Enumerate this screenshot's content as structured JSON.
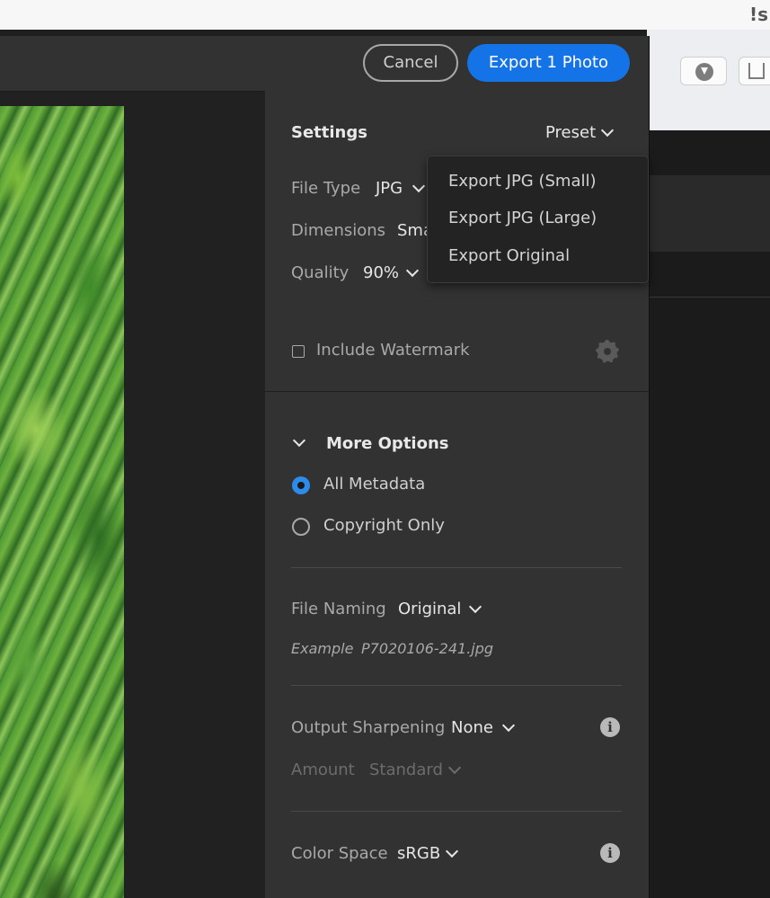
{
  "dialog": {
    "cancel_label": "Cancel",
    "export_label": "Export 1 Photo"
  },
  "settings": {
    "title": "Settings",
    "preset_label": "Preset",
    "file_type_label": "File Type",
    "file_type_value": "JPG",
    "dimensions_label": "Dimensions",
    "dimensions_value": "Sma",
    "quality_label": "Quality",
    "quality_value": "90%",
    "watermark_label": "Include Watermark",
    "watermark_checked": false
  },
  "preset_menu": {
    "items": [
      "Export JPG (Small)",
      "Export JPG (Large)",
      "Export Original"
    ]
  },
  "more_options": {
    "title": "More Options",
    "metadata_options": [
      {
        "label": "All Metadata",
        "selected": true
      },
      {
        "label": "Copyright Only",
        "selected": false
      }
    ],
    "file_naming_label": "File Naming",
    "file_naming_value": "Original",
    "example_label": "Example",
    "example_value": "P7020106-241.jpg",
    "output_sharpening_label": "Output Sharpening",
    "output_sharpening_value": "None",
    "amount_label": "Amount",
    "amount_value": "Standard",
    "color_space_label": "Color Space",
    "color_space_value": "sRGB"
  },
  "browser": {
    "corner_glyph": "!s"
  },
  "colors": {
    "accent": "#1473e6",
    "radio_selected": "#2d8ceb",
    "panel_bg": "#323232"
  }
}
